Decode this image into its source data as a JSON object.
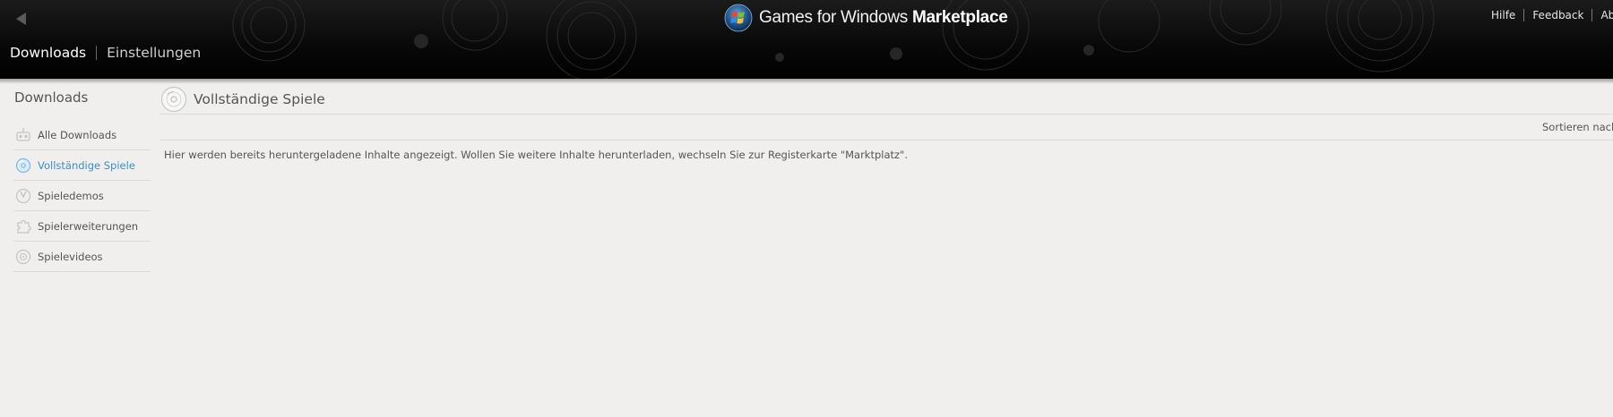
{
  "header": {
    "brand_regular": "Games for Windows",
    "brand_bold": "Marketplace",
    "links": [
      {
        "label": "Hilfe"
      },
      {
        "label": "Feedback"
      },
      {
        "label": "Abme"
      }
    ],
    "nav": [
      {
        "label": "Downloads",
        "active": true
      },
      {
        "label": "Einstellungen",
        "active": false
      }
    ]
  },
  "sidebar": {
    "title": "Downloads",
    "items": [
      {
        "label": "Alle Downloads",
        "icon": "all-downloads-icon",
        "selected": false
      },
      {
        "label": "Vollständige Spiele",
        "icon": "disc-icon",
        "selected": true
      },
      {
        "label": "Spieledemos",
        "icon": "demo-icon",
        "selected": false
      },
      {
        "label": "Spielerweiterungen",
        "icon": "puzzle-icon",
        "selected": false
      },
      {
        "label": "Spielevideos",
        "icon": "video-icon",
        "selected": false
      }
    ]
  },
  "content": {
    "title": "Vollständige Spiele",
    "title_icon": "disc-icon",
    "sort_label": "Sortieren nach:",
    "message": "Hier werden bereits heruntergeladene Inhalte angezeigt. Wollen Sie weitere Inhalte herunterladen, wechseln Sie zur Registerkarte \"Marktplatz\"."
  },
  "colors": {
    "header_bg": "#000000",
    "page_bg": "#f0efed",
    "accent": "#3a8ec9",
    "text": "#555555"
  }
}
